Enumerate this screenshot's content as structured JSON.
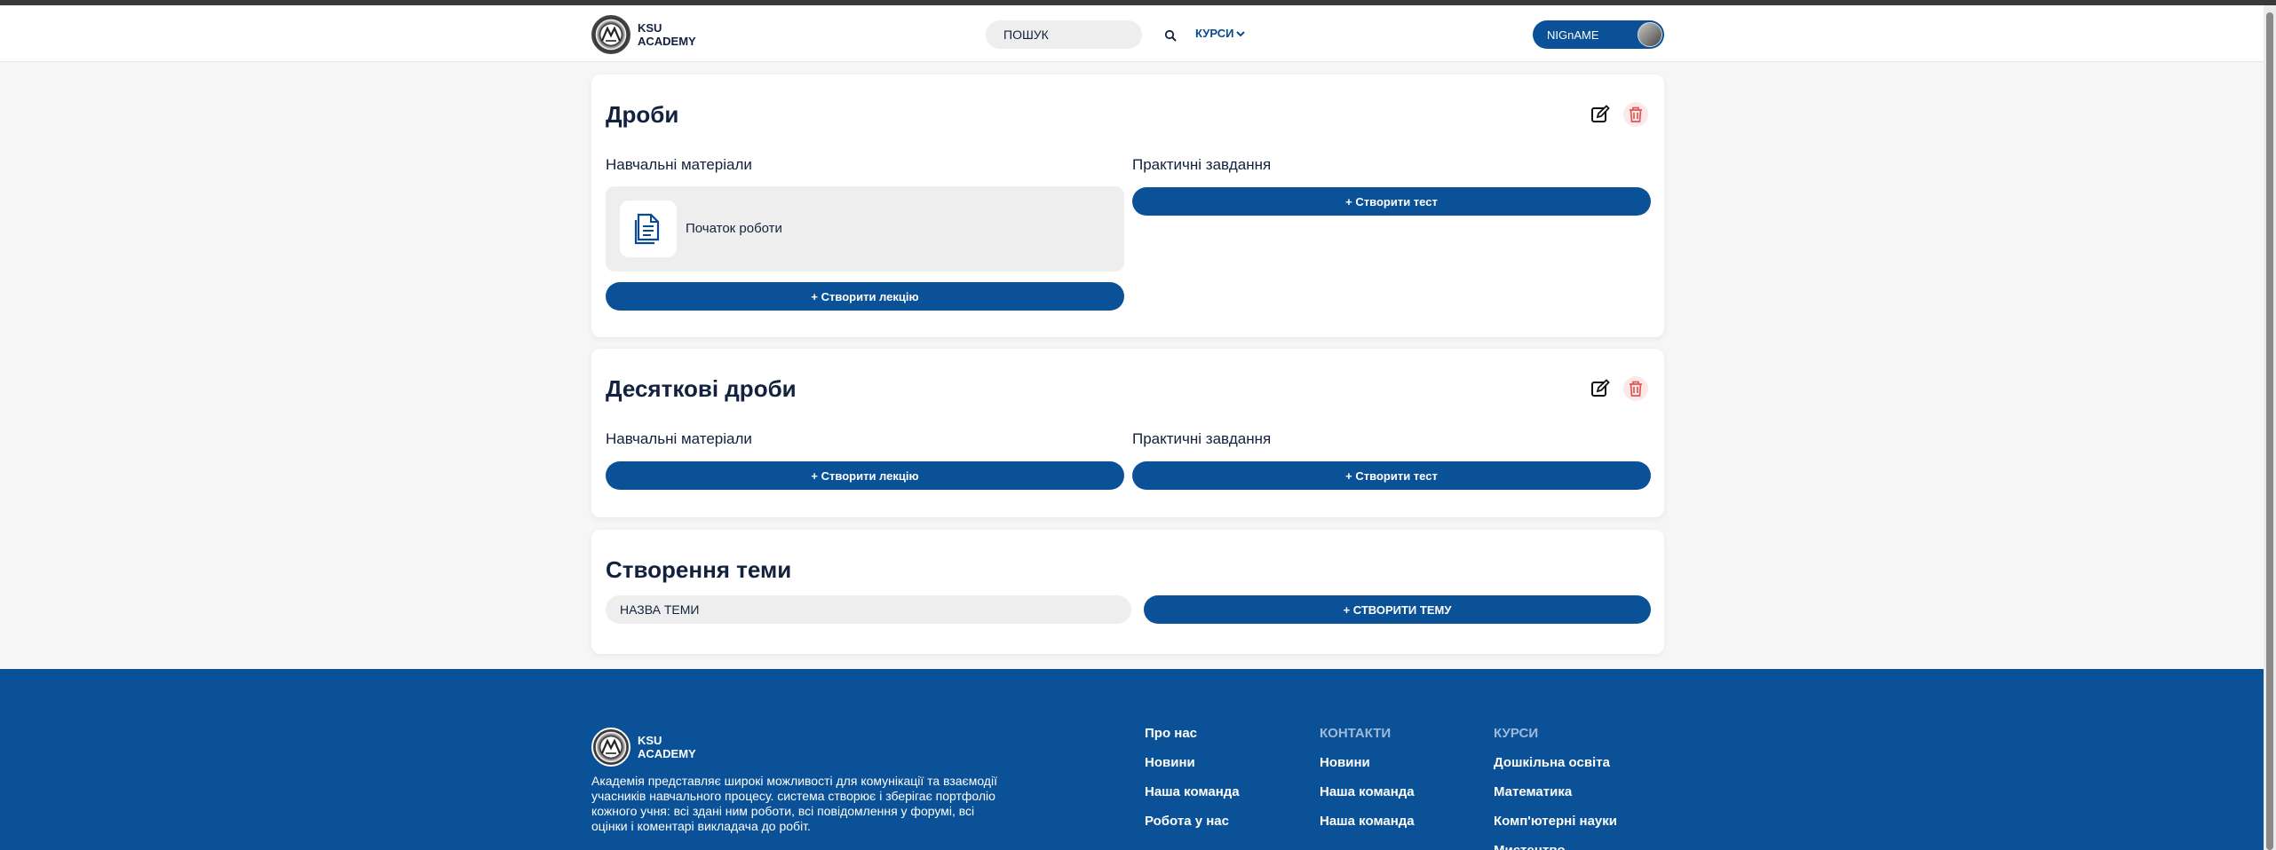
{
  "header": {
    "logo_line1": "KSU",
    "logo_line2": "ACADEMY",
    "search_placeholder": "ПОШУК",
    "courses_menu": "КУРСИ",
    "user_name": "NIGnAME"
  },
  "topics": [
    {
      "title": "Дроби",
      "materials_label": "Навчальні матеріали",
      "tasks_label": "Практичні завдання",
      "materials": [
        {
          "title": "Початок роботи"
        }
      ],
      "create_lecture_label": "+ Створити лекцію",
      "create_test_label": "+ Створити тест"
    },
    {
      "title": "Десяткові дроби",
      "materials_label": "Навчальні матеріали",
      "tasks_label": "Практичні завдання",
      "materials": [],
      "create_lecture_label": "+ Створити лекцію",
      "create_test_label": "+ Створити тест"
    }
  ],
  "create_topic": {
    "title": "Створення теми",
    "input_placeholder": "НАЗВА ТЕМИ",
    "button_label": "+ СТВОРИТИ ТЕМУ"
  },
  "footer": {
    "logo_line1": "KSU",
    "logo_line2": "ACADEMY",
    "description": "Академія представляє широкі можливості для комунікації та взаємодії учасників навчального процесу. система створює і зберігає портфоліо кожного учня: всі здані ним роботи, всі повідомлення у форумі, всі оцінки і коментарі викладача до робіт.",
    "columns": [
      {
        "title": "Про нас",
        "links": [
          "Новини",
          "Наша команда",
          "Робота у нас"
        ]
      },
      {
        "title": "КОНТАКТИ",
        "links": [
          "Новини",
          "Наша команда",
          "Наша команда"
        ]
      },
      {
        "title": "КУРСИ",
        "links": [
          "Дошкільна освіта",
          "Математика",
          "Комп'ютерні науки",
          "Мистецтво"
        ]
      }
    ]
  },
  "colors": {
    "primary": "#0a5197",
    "text_dark": "#12213d",
    "muted_footer_title": "#9fb9d8",
    "danger": "#e05555"
  }
}
